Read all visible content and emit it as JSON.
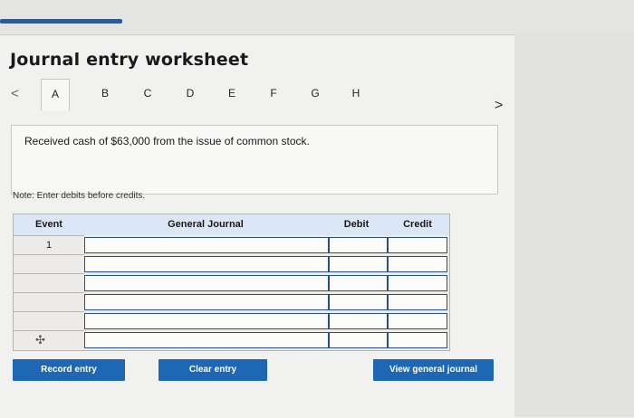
{
  "title": "Journal entry worksheet",
  "nav": {
    "prev_icon": "chevron-left-icon",
    "next_icon": "chevron-right-icon",
    "prev_glyph": "<",
    "next_glyph": ">"
  },
  "tabs": [
    {
      "label": "A",
      "active": true
    },
    {
      "label": "B"
    },
    {
      "label": "C"
    },
    {
      "label": "D"
    },
    {
      "label": "E"
    },
    {
      "label": "F"
    },
    {
      "label": "G"
    },
    {
      "label": "H"
    }
  ],
  "description": "Received cash of $63,000 from the issue of common stock.",
  "note": "Note: Enter debits before credits.",
  "table": {
    "headers": {
      "event": "Event",
      "general_journal": "General Journal",
      "debit": "Debit",
      "credit": "Credit"
    },
    "rows": [
      {
        "event": "1",
        "account": "",
        "debit": "",
        "credit": ""
      },
      {
        "event": "",
        "account": "",
        "debit": "",
        "credit": ""
      },
      {
        "event": "",
        "account": "",
        "debit": "",
        "credit": ""
      },
      {
        "event": "",
        "account": "",
        "debit": "",
        "credit": ""
      },
      {
        "event": "",
        "account": "",
        "debit": "",
        "credit": ""
      },
      {
        "event": "",
        "account": "",
        "debit": "",
        "credit": ""
      }
    ],
    "add_row_icon": "plus-icon",
    "add_row_glyph": "✣"
  },
  "buttons": {
    "record": "Record entry",
    "clear": "Clear entry",
    "view": "View general journal"
  },
  "colors": {
    "accent": "#1d67b5",
    "header_bg": "#dbe6f6",
    "progress": "#1f5fa8"
  }
}
